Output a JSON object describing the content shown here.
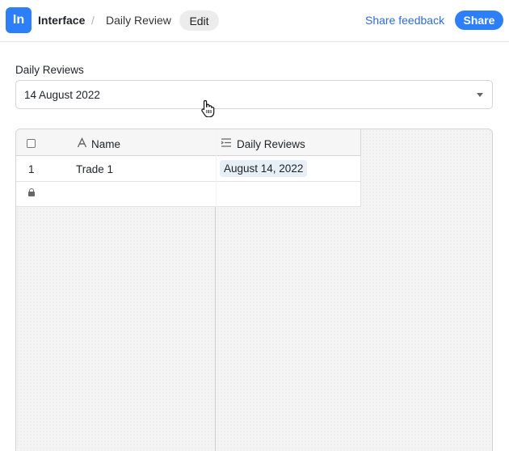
{
  "header": {
    "logo_text": "In",
    "app_name": "Interface",
    "separator": "/",
    "page_name": "Daily Review",
    "edit_label": "Edit",
    "feedback_label": "Share feedback",
    "share_label": "Share"
  },
  "filter": {
    "label": "Daily Reviews",
    "value": "14 August 2022"
  },
  "table": {
    "columns": [
      {
        "label": "Name",
        "icon": "text-field-icon"
      },
      {
        "label": "Daily Reviews",
        "icon": "linked-list-icon"
      }
    ],
    "rows": [
      {
        "number": "1",
        "name": "Trade 1",
        "daily_review": "August 14, 2022"
      }
    ]
  },
  "colors": {
    "accent": "#2d7ff9",
    "link": "#2d6bd9"
  }
}
